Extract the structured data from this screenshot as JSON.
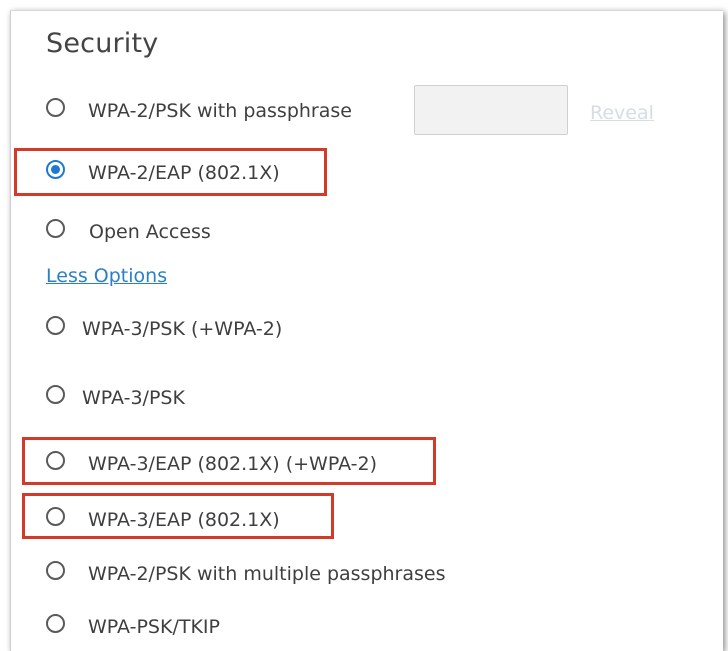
{
  "security": {
    "title": "Security",
    "options": [
      {
        "label": "WPA-2/PSK with passphrase",
        "selected": false
      },
      {
        "label": "WPA-2/EAP (802.1X)",
        "selected": true
      },
      {
        "label": "Open Access",
        "selected": false
      },
      {
        "label": "WPA-3/PSK (+WPA-2)",
        "selected": false
      },
      {
        "label": "WPA-3/PSK",
        "selected": false
      },
      {
        "label": "WPA-3/EAP (802.1X) (+WPA-2)",
        "selected": false
      },
      {
        "label": "WPA-3/EAP (802.1X)",
        "selected": false
      },
      {
        "label": "WPA-2/PSK with multiple passphrases",
        "selected": false
      },
      {
        "label": "WPA-PSK/TKIP",
        "selected": false
      }
    ],
    "passphrase_value": "",
    "reveal_label": "Reveal",
    "less_options_label": "Less Options"
  },
  "colors": {
    "accent": "#1f78d8",
    "link": "#2a80c8",
    "highlight": "#d43a2a"
  }
}
